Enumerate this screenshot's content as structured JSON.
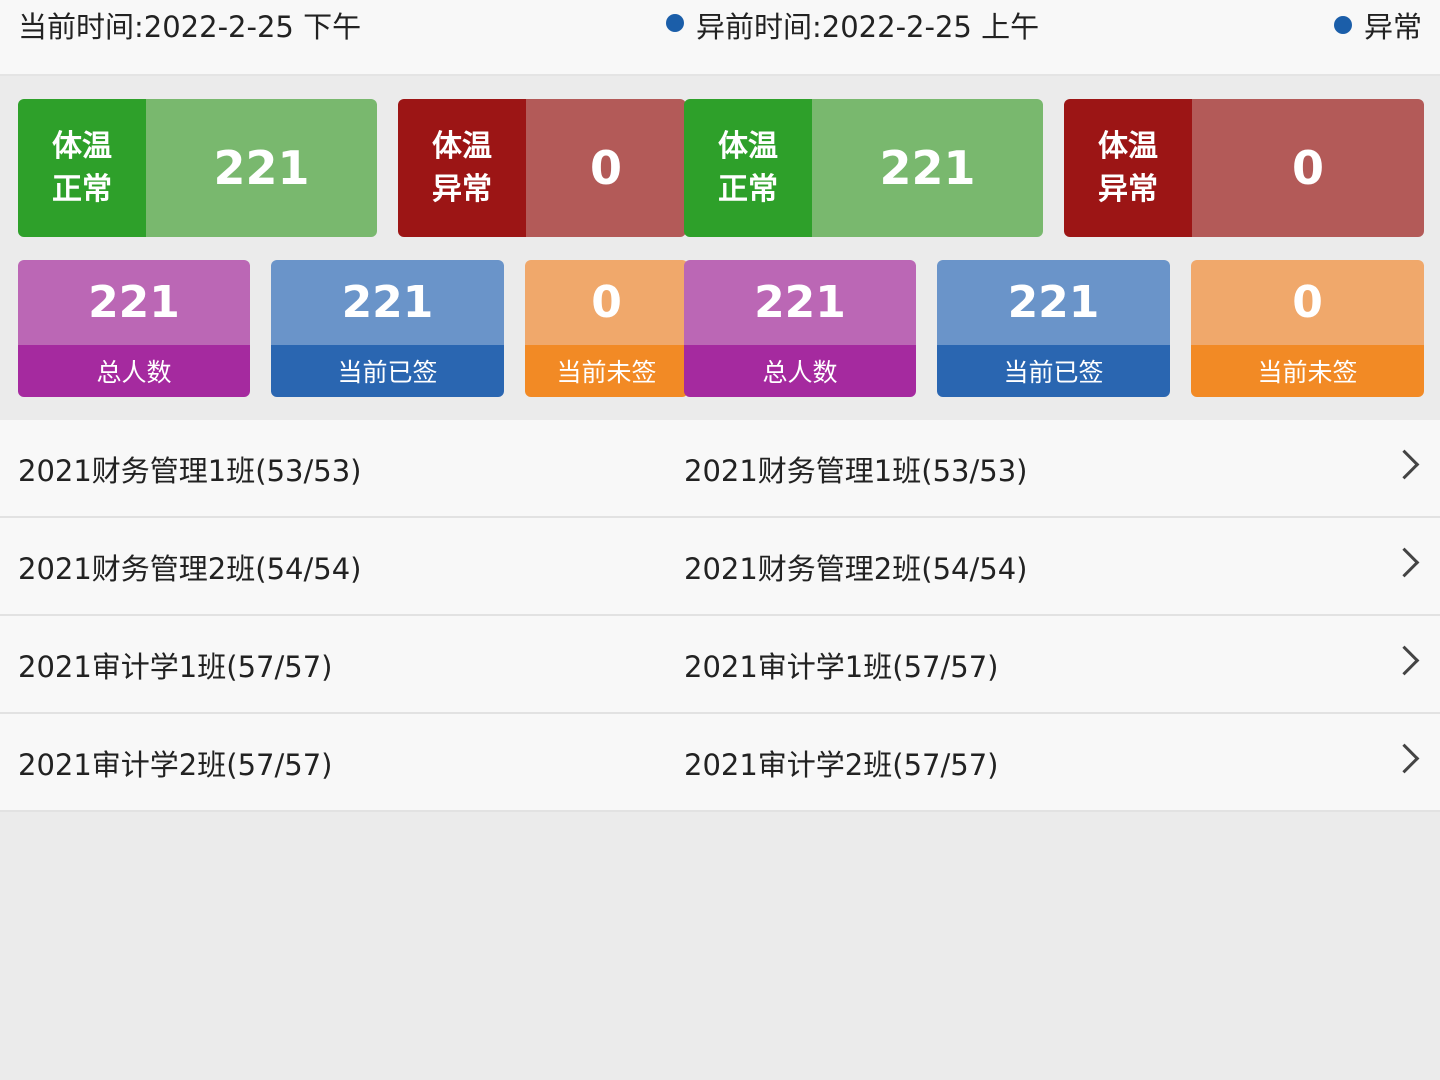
{
  "header": {
    "time_left": "当前时间:2022-2-25 下午",
    "time_right": "异前时间:2022-2-25 上午",
    "status_right": "异常"
  },
  "panel_a": {
    "temp_normal": {
      "label_1": "体温",
      "label_2": "正常",
      "value": "221"
    },
    "temp_abnormal": {
      "label_1": "体温",
      "label_2": "异常",
      "value": "0"
    },
    "total": {
      "value": "221",
      "label": "总人数"
    },
    "signed": {
      "value": "221",
      "label": "当前已签"
    },
    "unsigned": {
      "value": "0",
      "label": "当前未签"
    }
  },
  "panel_b": {
    "temp_normal": {
      "label_1": "体温",
      "label_2": "正常",
      "value": "221"
    },
    "temp_abnormal": {
      "label_1": "体温",
      "label_2": "异常",
      "value": "0"
    },
    "total": {
      "value": "221",
      "label": "总人数"
    },
    "signed": {
      "value": "221",
      "label": "当前已签"
    },
    "unsigned": {
      "value": "0",
      "label": "当前未签"
    }
  },
  "classes": [
    {
      "name": "2021财务管理1班(53/53)"
    },
    {
      "name": "2021财务管理2班(54/54)"
    },
    {
      "name": "2021审计学1班(57/57)"
    },
    {
      "name": "2021审计学2班(57/57)"
    }
  ],
  "colors": {
    "green_dark": "#2ea02a",
    "green_light": "#79b86e",
    "red_dark": "#9c1515",
    "red_light": "#b35a58",
    "purple_dark": "#a52a9f",
    "purple_light": "#bb67b5",
    "blue_dark": "#2a66b1",
    "blue_light": "#6a94c9",
    "orange_dark": "#f28a25",
    "orange_light": "#f0a86b",
    "status_dot": "#1b5ea9"
  }
}
